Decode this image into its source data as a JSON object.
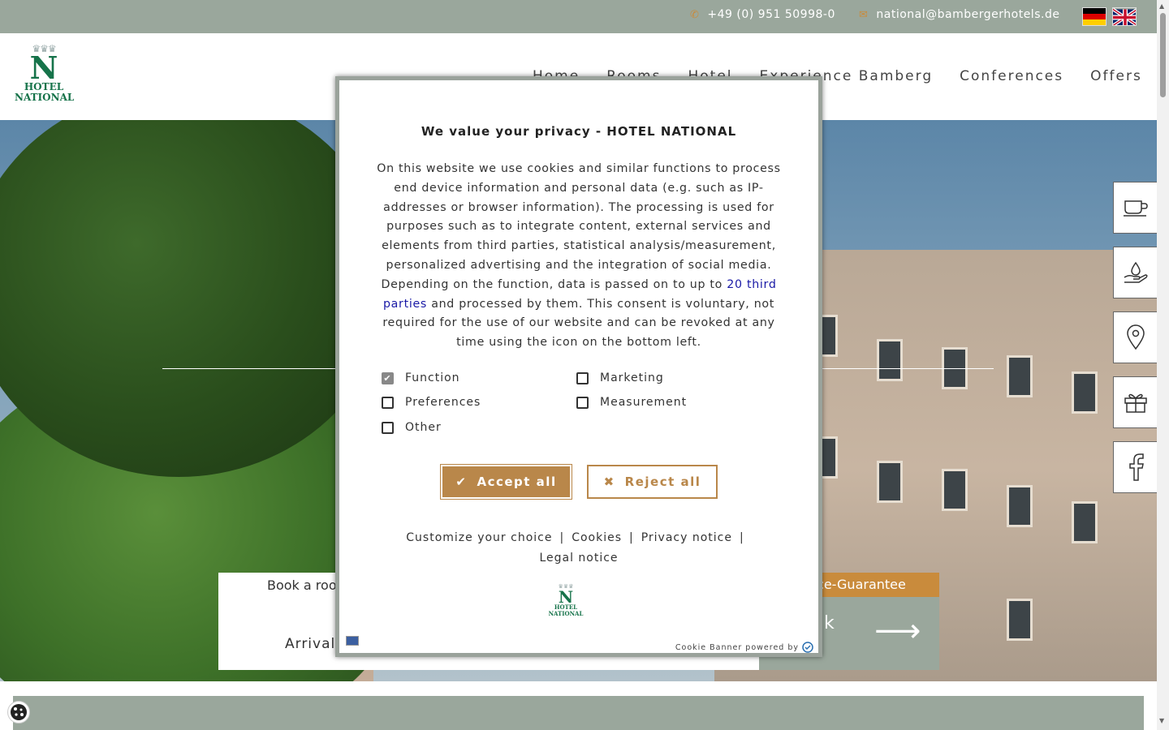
{
  "topbar": {
    "phone": "+49 (0) 951 50998-0",
    "email": "national@bambergerhotels.de",
    "languages": [
      "de",
      "en"
    ]
  },
  "header": {
    "logo_line1": "HOTEL",
    "logo_line2": "NATIONAL",
    "logo_letter": "N",
    "nav": [
      "Home",
      "Rooms",
      "Hotel",
      "Experience Bamberg",
      "Conferences",
      "Offers"
    ]
  },
  "hero": {
    "booking_label": "Book a roo",
    "arrival_label": "Arrival",
    "best_price_label": "rice-Guarantee",
    "best_price_fragment": "k"
  },
  "side_icons": [
    "coffee-cup-icon",
    "spa-icon",
    "location-pin-icon",
    "gift-icon",
    "facebook-icon"
  ],
  "consent": {
    "title": "We value your privacy - HOTEL NATIONAL",
    "body_before_link": "On this website we use cookies and similar functions to process end device information and personal data (e.g. such as IP-addresses or browser information). The processing is used for purposes such as to integrate content, external services and elements from third parties, statistical analysis/measurement, personalized advertising and the integration of social media. Depending on the function, data is passed on to up to ",
    "third_parties_link": "20 third parties",
    "body_after_link": " and processed by them. This consent is voluntary, not required for the use of our website and can be revoked at any time using the icon on the bottom left.",
    "categories": [
      {
        "label": "Function",
        "checked": true
      },
      {
        "label": "Marketing",
        "checked": false
      },
      {
        "label": "Preferences",
        "checked": false
      },
      {
        "label": "Measurement",
        "checked": false
      },
      {
        "label": "Other",
        "checked": false
      }
    ],
    "accept_label": "Accept all",
    "reject_label": "Reject all",
    "links": {
      "customize": "Customize your choice",
      "cookies": "Cookies",
      "privacy": "Privacy notice",
      "legal": "Legal notice",
      "separator": "|"
    },
    "powered_by": "Cookie Banner powered by"
  },
  "colors": {
    "accent": "#c98b3c",
    "sage": "#9aa79c",
    "brand_green": "#16734a",
    "link_blue": "#1a1aa6"
  }
}
